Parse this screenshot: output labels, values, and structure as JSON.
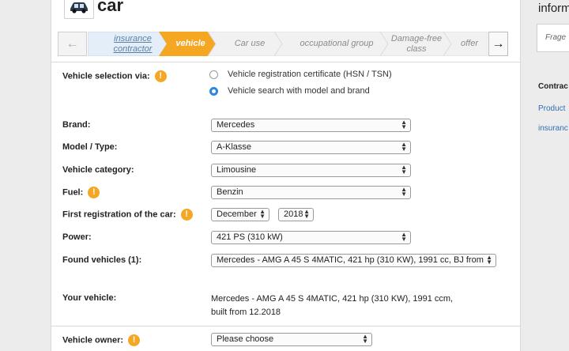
{
  "page": {
    "title": "car",
    "car_icon": "car-icon"
  },
  "stepper": {
    "prev_icon": "arrow-left-icon",
    "next_icon": "arrow-right-icon",
    "steps": [
      {
        "label": "insurance contractor",
        "state": "done"
      },
      {
        "label": "vehicle",
        "state": "active"
      },
      {
        "label": "Car use",
        "state": "todo"
      },
      {
        "label": "occupational group",
        "state": "todo"
      },
      {
        "label": "Damage-free class",
        "state": "todo"
      },
      {
        "label": "offer",
        "state": "todo"
      }
    ],
    "colors": {
      "done": "#e4eef8",
      "active": "#f5a623",
      "todo": "#f1f1f1"
    }
  },
  "form": {
    "selection_label": "Vehicle selection via:",
    "radio_options": [
      {
        "label": "Vehicle registration certificate (HSN / TSN)",
        "selected": false
      },
      {
        "label": "Vehicle search with model and brand",
        "selected": true
      }
    ],
    "brand": {
      "label": "Brand:",
      "value": "Mercedes"
    },
    "model": {
      "label": "Model / Type:",
      "value": "A-Klasse"
    },
    "category": {
      "label": "Vehicle category:",
      "value": "Limousine"
    },
    "fuel": {
      "label": "Fuel:",
      "value": "Benzin"
    },
    "first_registration": {
      "label": "First registration of the car:",
      "month": "December",
      "year": "2018"
    },
    "power": {
      "label": "Power:",
      "value": "421 PS (310 kW)"
    },
    "found": {
      "label": "Found vehicles (1):",
      "value": "Mercedes - AMG A 45 S 4MATIC, 421 hp (310 KW), 1991 cc, BJ from"
    },
    "your_vehicle": {
      "label": "Your vehicle:",
      "line1": "Mercedes - AMG A 45 S 4MATIC, 421 hp (310 KW), 1991 ccm,",
      "line2": "built from 12.2018"
    },
    "owner": {
      "label": "Vehicle owner:",
      "value": "Please choose"
    },
    "info_icon": "!",
    "accent": "#f5a623",
    "radio_accent": "#2f86e0"
  },
  "sidebar": {
    "title": "inform",
    "input_placeholder": "Frage",
    "heading": "Contrac",
    "links": [
      "Product",
      "insuranc"
    ],
    "link_color": "#2f6fb3"
  }
}
